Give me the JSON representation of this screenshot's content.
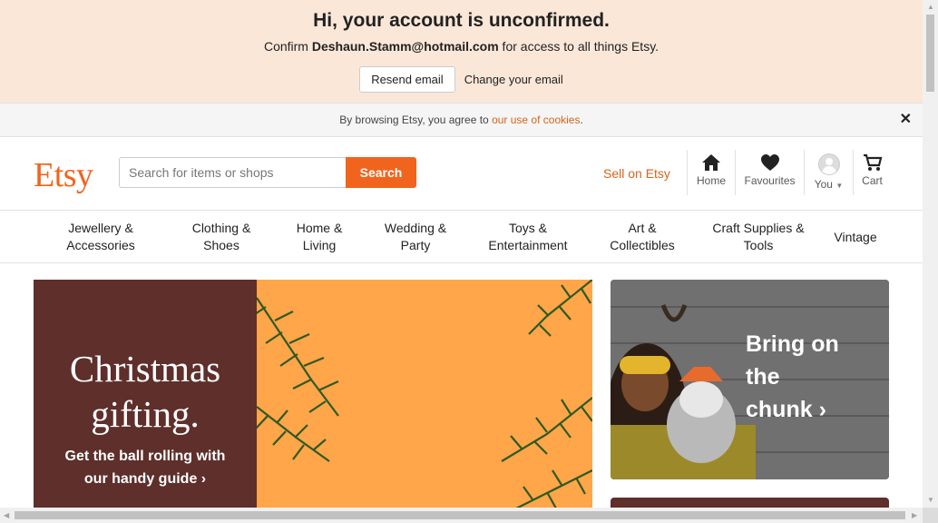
{
  "banner": {
    "title": "Hi, your account is unconfirmed.",
    "sub_prefix": "Confirm ",
    "email": "Deshaun.Stamm@hotmail.com",
    "sub_suffix": " for access to all things Etsy.",
    "resend_label": "Resend email",
    "change_label": "Change your email"
  },
  "cookie": {
    "text": "By browsing Etsy, you agree to ",
    "link": "our use of cookies",
    "suffix": ".",
    "close": "✕"
  },
  "header": {
    "logo": "Etsy",
    "search_placeholder": "Search for items or shops",
    "search_button": "Search",
    "sell": "Sell on Etsy",
    "nav": {
      "home": "Home",
      "favourites": "Favourites",
      "you": "You",
      "cart": "Cart"
    }
  },
  "categories": [
    "Jewellery & Accessories",
    "Clothing & Shoes",
    "Home & Living",
    "Wedding & Party",
    "Toys & Entertainment",
    "Art & Collectibles",
    "Craft Supplies & Tools",
    "Vintage"
  ],
  "hero": {
    "title_line1": "Christmas",
    "title_line2": "gifting.",
    "cta_line1": "Get the ball rolling with",
    "cta_line2": "our handy guide ›"
  },
  "card": {
    "line1": "Bring on",
    "line2": "the",
    "line3": "chunk ›"
  },
  "colors": {
    "brand": "#f1641e",
    "banner_bg": "#fbe7d8",
    "hero_left": "#5e2f2b",
    "hero_right": "#ffa54a"
  }
}
